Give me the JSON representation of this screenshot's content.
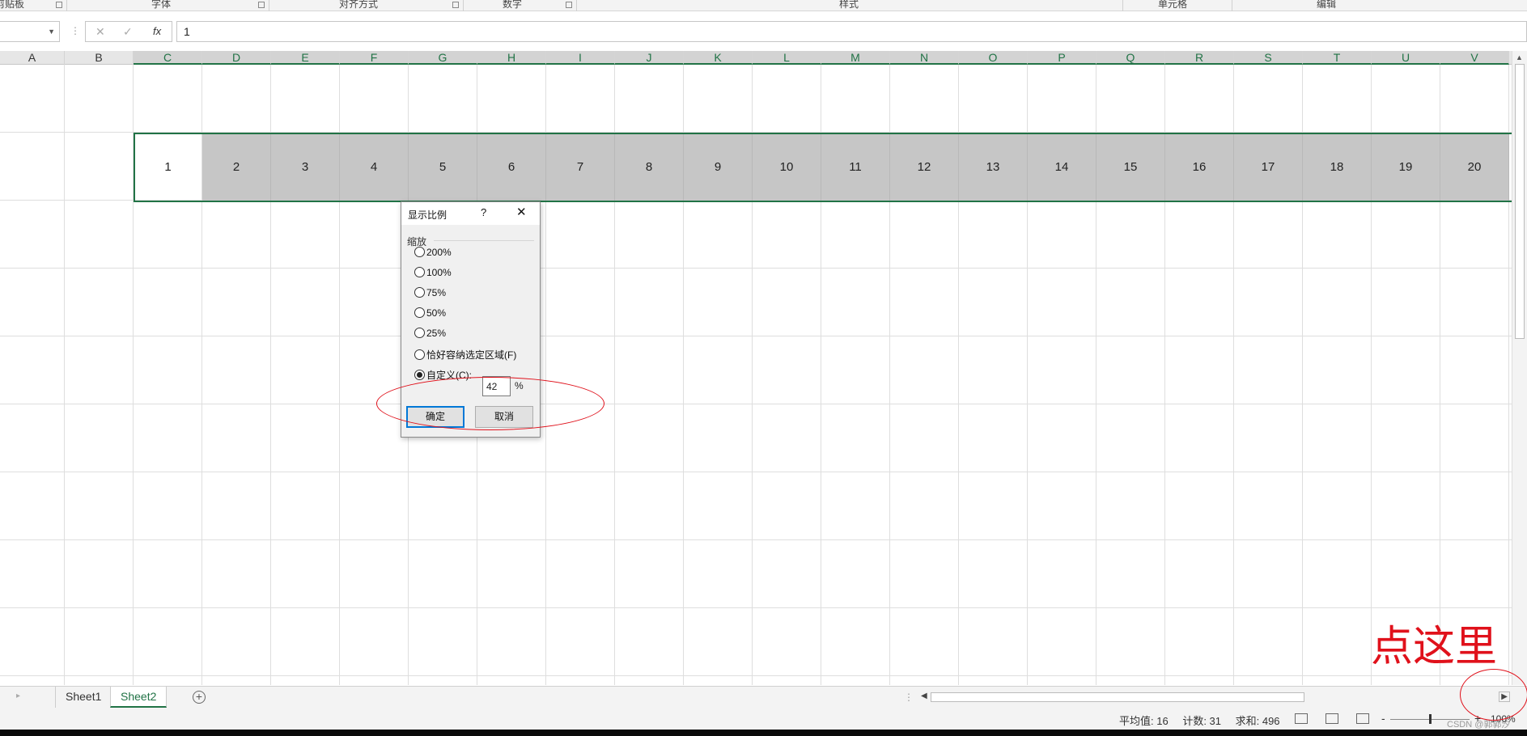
{
  "ribbon": {
    "groups": [
      {
        "label": "剪贴板"
      },
      {
        "label": "字体"
      },
      {
        "label": "对齐方式"
      },
      {
        "label": "数字"
      },
      {
        "label": "样式"
      },
      {
        "label": "单元格"
      },
      {
        "label": "编辑"
      }
    ]
  },
  "formula_bar": {
    "name_box_value": "",
    "cancel_icon": "✕",
    "enter_icon": "✓",
    "fx_label": "fx",
    "formula_value": "1"
  },
  "columns": [
    "A",
    "B",
    "C",
    "D",
    "E",
    "F",
    "G",
    "H",
    "I",
    "J",
    "K",
    "L",
    "M",
    "N",
    "O",
    "P",
    "Q",
    "R",
    "S",
    "T",
    "U",
    "V"
  ],
  "row2_values": [
    "1",
    "2",
    "3",
    "4",
    "5",
    "6",
    "7",
    "8",
    "9",
    "10",
    "11",
    "12",
    "13",
    "14",
    "15",
    "16",
    "17",
    "18",
    "19",
    "20"
  ],
  "dialog": {
    "title": "显示比例",
    "help": "?",
    "close": "✕",
    "group_label": "缩放",
    "options": [
      {
        "label": "200%",
        "checked": false
      },
      {
        "label": "100%",
        "checked": false
      },
      {
        "label": "75%",
        "checked": false
      },
      {
        "label": "50%",
        "checked": false
      },
      {
        "label": "25%",
        "checked": false
      },
      {
        "label": "恰好容纳选定区域(F)",
        "checked": false
      },
      {
        "label": "自定义(C):",
        "checked": true
      }
    ],
    "custom_value": "42",
    "percent_sign": "%",
    "ok_label": "确定",
    "cancel_label": "取消"
  },
  "sheets": {
    "tabs": [
      {
        "label": "Sheet1",
        "active": false
      },
      {
        "label": "Sheet2",
        "active": true
      }
    ],
    "add_icon": "+"
  },
  "status_bar": {
    "average": "平均值: 16",
    "count": "计数: 31",
    "sum": "求和: 496",
    "zoom_minus": "-",
    "zoom_plus": "+",
    "zoom_percent": "100%",
    "zoom_level": 1.0
  },
  "annotation": {
    "text": "点这里",
    "color": "#e0111b"
  },
  "watermark": "CSDN @郭郭汐",
  "colors": {
    "accent": "#217346",
    "selection_fill": "#c6c6c6",
    "dialog_focus": "#0078d7"
  }
}
